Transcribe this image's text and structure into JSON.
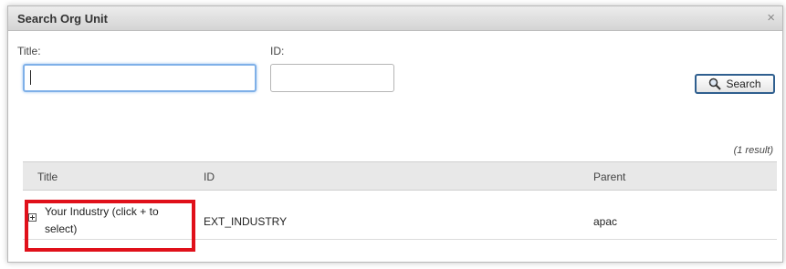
{
  "dialog": {
    "title": "Search Org Unit",
    "close_glyph": "×"
  },
  "form": {
    "title_label": "Title:",
    "title_value": "",
    "id_label": "ID:",
    "id_value": "",
    "search_label": "Search"
  },
  "results": {
    "count_text": "(1 result)",
    "columns": [
      "Title",
      "ID",
      "Parent"
    ],
    "rows": [
      {
        "title": "Your Industry (click + to select)",
        "id": "EXT_INDUSTRY",
        "parent": "apac"
      }
    ]
  },
  "colors": {
    "highlight": "#e0101a",
    "focus_border": "#7fb0e8",
    "button_border": "#2f5f8f"
  },
  "icons": {
    "close": "close-icon",
    "search": "search-icon",
    "expand": "expand-plus-icon"
  }
}
